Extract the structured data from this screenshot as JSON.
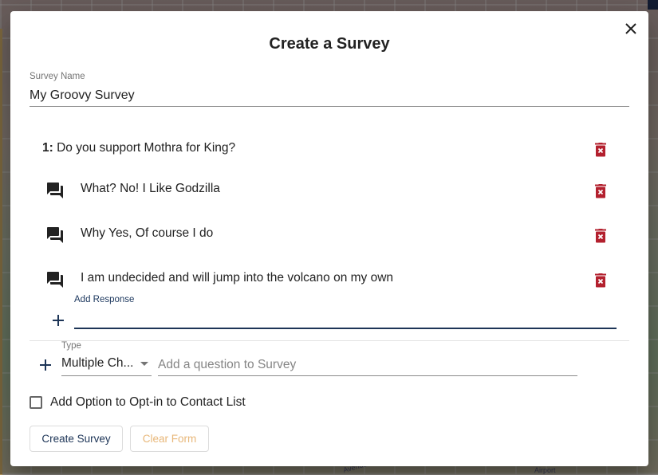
{
  "dialog": {
    "title": "Create a Survey",
    "close_icon": "close-icon"
  },
  "survey_name": {
    "label": "Survey Name",
    "value": "My Groovy Survey"
  },
  "questions": [
    {
      "number": "1:",
      "text": "Do you support Mothra for King?",
      "responses": [
        {
          "text": "What? No! I Like Godzilla"
        },
        {
          "text": "Why Yes, Of course I do"
        },
        {
          "text": "I am undecided and will jump into the volcano on my own"
        }
      ]
    }
  ],
  "add_response": {
    "label": "Add Response",
    "value": ""
  },
  "new_question": {
    "type_label": "Type",
    "type_value": "Multiple Ch...",
    "placeholder": "Add a question to Survey",
    "value": ""
  },
  "optin": {
    "label": "Add Option to Opt-in to Contact List",
    "checked": false
  },
  "buttons": {
    "create": "Create Survey",
    "clear": "Clear Form"
  },
  "map": {
    "labels": [
      "Avenue",
      "Airport"
    ]
  },
  "colors": {
    "delete": "#b3202e",
    "primary": "#1d3557",
    "clear": "#e8b779"
  }
}
